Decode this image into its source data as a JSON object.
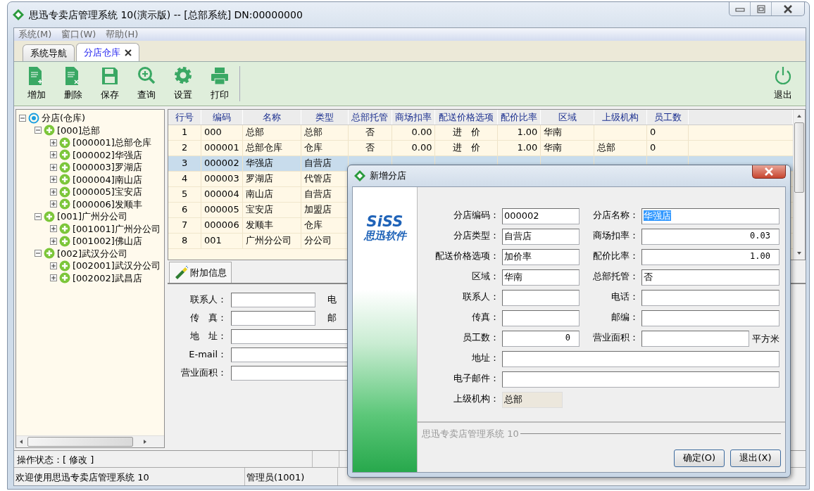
{
  "window": {
    "title": "思迅专卖店管理系统 10(演示版) -- [总部系统] DN:00000000"
  },
  "menu": [
    {
      "label": "系统(M)"
    },
    {
      "label": "窗口(W)"
    },
    {
      "label": "帮助(H)"
    }
  ],
  "tabs": [
    {
      "label": "系统导航",
      "selected": false,
      "closable": false
    },
    {
      "label": "分店仓库",
      "selected": true,
      "closable": true
    }
  ],
  "toolbar": {
    "items": [
      {
        "label": "增加",
        "kind": "add"
      },
      {
        "label": "删除",
        "kind": "delete"
      },
      {
        "label": "保存",
        "kind": "save"
      },
      {
        "label": "查询",
        "kind": "search"
      },
      {
        "label": "设置",
        "kind": "settings"
      },
      {
        "label": "打印",
        "kind": "print"
      }
    ],
    "exit": {
      "label": "退出"
    }
  },
  "tree": {
    "label": "分店(仓库)",
    "expanded": true,
    "children": [
      {
        "label": "[000]总部",
        "expanded": true,
        "children": [
          {
            "label": "[000001]总部仓库",
            "expanded": false
          },
          {
            "label": "[000002]华强店",
            "expanded": false
          },
          {
            "label": "[000003]罗湖店",
            "expanded": false
          },
          {
            "label": "[000004]南山店",
            "expanded": false
          },
          {
            "label": "[000005]宝安店",
            "expanded": false
          },
          {
            "label": "[000006]发顺丰",
            "expanded": false
          }
        ]
      },
      {
        "label": "[001]广州分公司",
        "expanded": true,
        "children": [
          {
            "label": "[001001]广州分公司",
            "expanded": false
          },
          {
            "label": "[001002]佛山店",
            "expanded": false
          }
        ]
      },
      {
        "label": "[002]武汉分公司",
        "expanded": true,
        "children": [
          {
            "label": "[002001]武汉分公司",
            "expanded": false
          },
          {
            "label": "[002002]武昌店",
            "expanded": false
          }
        ]
      }
    ]
  },
  "table": {
    "columns": [
      "行号",
      "编码",
      "名称",
      "类型",
      "总部托管",
      "商场扣率",
      "配送价格选项",
      "配价比率",
      "区域",
      "上级机构",
      "员工数"
    ],
    "rows": [
      {
        "selected": false,
        "cells": [
          "1",
          "000",
          "总部",
          "总部",
          "否",
          "0.00",
          "进　价",
          "1.00",
          "华南",
          null,
          "0"
        ]
      },
      {
        "selected": false,
        "cells": [
          "2",
          "000001",
          "总部仓库",
          "仓库",
          "否",
          "0.00",
          "进　价",
          "1.00",
          "华南",
          "总部",
          "0"
        ]
      },
      {
        "selected": true,
        "cells": [
          "3",
          "000002",
          "华强店",
          "自营店"
        ]
      },
      {
        "selected": false,
        "cells": [
          "4",
          "000003",
          "罗湖店",
          "代管店"
        ]
      },
      {
        "selected": false,
        "cells": [
          "5",
          "000004",
          "南山店",
          "自营店"
        ]
      },
      {
        "selected": false,
        "cells": [
          "6",
          "000005",
          "宝安店",
          "加盟店"
        ]
      },
      {
        "selected": false,
        "cells": [
          "7",
          "000006",
          "发顺丰",
          "仓库"
        ]
      },
      {
        "selected": false,
        "cells": [
          "8",
          "001",
          "广州分公司",
          "分公司"
        ]
      }
    ]
  },
  "detail": {
    "tab": {
      "label": "附加信息"
    },
    "fields": [
      {
        "label": "联系人：",
        "kind": "short",
        "side_label": "电"
      },
      {
        "label": "传　真：",
        "kind": "short",
        "side_label": "邮"
      },
      {
        "label": "地　址：",
        "kind": "wide"
      },
      {
        "label": "E-mail：",
        "kind": "wide"
      },
      {
        "label": "营业面积：",
        "kind": "wide"
      }
    ]
  },
  "status": {
    "operation": "操作状态：[ 修改 ]",
    "welcome": "欢迎使用思迅专卖店管理系统 10",
    "user": "管理员(1001)"
  },
  "dialog": {
    "title": "新增分店",
    "logo": {
      "mark": "SiSS",
      "text": "思迅软件"
    },
    "rows": [
      {
        "kind": "pair",
        "fields": [
          {
            "label": "分店编码：",
            "value": "000002",
            "kind": "text"
          },
          {
            "label": "分店名称：",
            "value": "华强店",
            "kind": "text",
            "highlighted": true
          }
        ]
      },
      {
        "kind": "pair",
        "fields": [
          {
            "label": "分店类型：",
            "value": "自营店",
            "kind": "text"
          },
          {
            "label": "商场扣率：",
            "value": "0.03",
            "kind": "number"
          }
        ]
      },
      {
        "kind": "pair",
        "fields": [
          {
            "label": "配送价格选项：",
            "value": "加价率",
            "kind": "text"
          },
          {
            "label": "配价比率：",
            "value": "1.00",
            "kind": "number"
          }
        ]
      },
      {
        "kind": "pair",
        "fields": [
          {
            "label": "区域：",
            "value": "华南",
            "kind": "text"
          },
          {
            "label": "总部托管：",
            "value": "否",
            "kind": "text"
          }
        ]
      },
      {
        "kind": "pair",
        "fields": [
          {
            "label": "联系人：",
            "kind": "text"
          },
          {
            "label": "电话：",
            "kind": "text"
          }
        ]
      },
      {
        "kind": "pair",
        "fields": [
          {
            "label": "传真：",
            "kind": "text"
          },
          {
            "label": "邮编：",
            "kind": "text"
          }
        ]
      },
      {
        "kind": "pair",
        "fields": [
          {
            "label": "员工数：",
            "value": "0",
            "kind": "number"
          },
          {
            "label": "营业面积：",
            "kind": "text",
            "unit": "平方米"
          }
        ]
      },
      {
        "kind": "wide",
        "fields": [
          {
            "label": "地址：",
            "kind": "text"
          }
        ]
      },
      {
        "kind": "wide",
        "fields": [
          {
            "label": "电子邮件：",
            "kind": "text"
          }
        ]
      },
      {
        "kind": "single",
        "fields": [
          {
            "label": "上级机构：",
            "value": "总部",
            "kind": "readonly"
          }
        ]
      }
    ],
    "footer": "思迅专卖店管理系统 10",
    "buttons": [
      {
        "label": "确定(O)"
      },
      {
        "label": "退出(X)"
      }
    ]
  }
}
